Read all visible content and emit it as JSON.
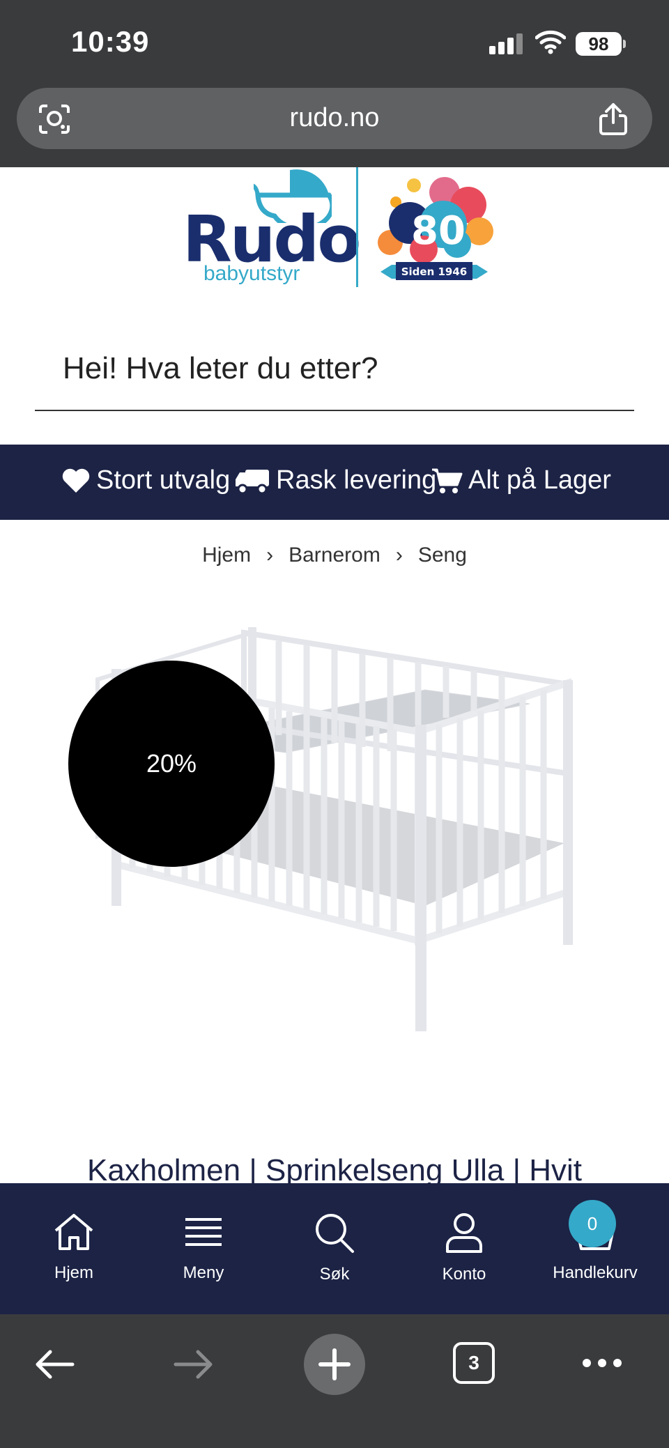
{
  "status_bar": {
    "time": "10:39",
    "battery": "98"
  },
  "browser": {
    "url": "rudo.no",
    "tab_count": "3"
  },
  "logo": {
    "brand": "Rudo",
    "tagline": "babyutstyr",
    "anniversary_number": "80",
    "anniversary_ribbon": "Siden 1946"
  },
  "search": {
    "placeholder": "Hei! Hva leter du etter?"
  },
  "usp": [
    {
      "icon": "heart-icon",
      "label": "Stort utvalg"
    },
    {
      "icon": "truck-icon",
      "label": "Rask levering"
    },
    {
      "icon": "cart-icon",
      "label": "Alt på Lager"
    }
  ],
  "breadcrumb": [
    "Hjem",
    "Barnerom",
    "Seng"
  ],
  "product": {
    "discount": "20%",
    "title": "Kaxholmen | Sprinkelseng Ulla | Hvit",
    "image": "crib-image"
  },
  "site_nav": [
    {
      "icon": "home-icon",
      "label": "Hjem"
    },
    {
      "icon": "menu-icon",
      "label": "Meny"
    },
    {
      "icon": "search-icon",
      "label": "Søk"
    },
    {
      "icon": "user-icon",
      "label": "Konto"
    },
    {
      "icon": "basket-icon",
      "label": "Handlekurv"
    }
  ],
  "cart_count": "0",
  "colors": {
    "navy": "#1c2345",
    "accent": "#35a9c9",
    "badge": "#000000",
    "chrome": "#3a3b3d"
  }
}
